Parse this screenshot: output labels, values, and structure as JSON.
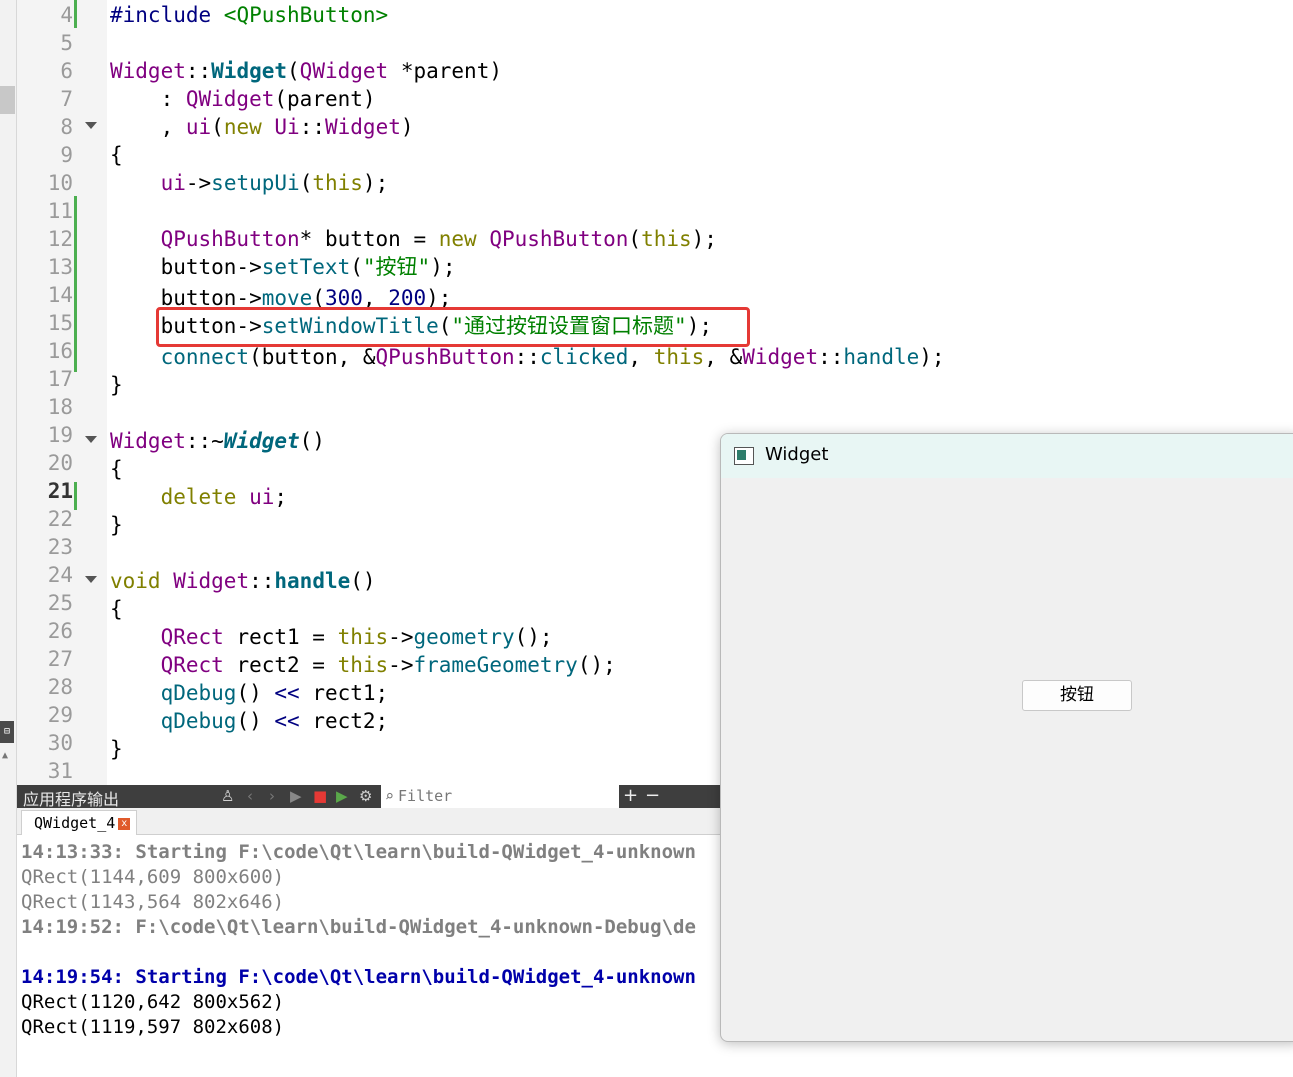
{
  "editor": {
    "line_numbers": [
      "4",
      "5",
      "6",
      "7",
      "8",
      "9",
      "10",
      "11",
      "12",
      "13",
      "14",
      "15",
      "16",
      "17",
      "18",
      "19",
      "20",
      "21",
      "22",
      "23",
      "24",
      "25",
      "26",
      "27",
      "28",
      "29",
      "30",
      "31"
    ],
    "current_line": "21",
    "lines": {
      "l4": {
        "a": "#include ",
        "b": "<QPushButton>"
      },
      "l6": {
        "a": "Widget",
        "b": "::",
        "c": "Widget",
        "d": "(",
        "e": "QWidget",
        "f": " *parent)"
      },
      "l7": {
        "a": "    : ",
        "b": "QWidget",
        "c": "(parent)"
      },
      "l8": {
        "a": "    , ",
        "b": "ui",
        "c": "(",
        "d": "new",
        "e": " ",
        "f": "Ui",
        "g": "::",
        "h": "Widget",
        "i": ")"
      },
      "l9": {
        "a": "{"
      },
      "l10": {
        "a": "    ",
        "b": "ui",
        "c": "->",
        "d": "setupUi",
        "e": "(",
        "f": "this",
        "g": ");"
      },
      "l12": {
        "a": "    ",
        "b": "QPushButton",
        "c": "* button = ",
        "d": "new",
        "e": " ",
        "f": "QPushButton",
        "g": "(",
        "h": "this",
        "i": ");"
      },
      "l13": {
        "a": "    button->",
        "b": "setText",
        "c": "(",
        "d": "\"按钮\"",
        "e": ");"
      },
      "l14": {
        "a": "    button->",
        "b": "move",
        "c": "(",
        "d": "300",
        "e": ", ",
        "f": "200",
        "g": ");"
      },
      "l15": {
        "a": "    button->",
        "b": "setWindowTitle",
        "c": "(",
        "d": "\"通过按钮设置窗口标题\"",
        "e": ");"
      },
      "l16": {
        "a": "    ",
        "b": "connect",
        "c": "(button, &",
        "d": "QPushButton",
        "e": "::",
        "f": "clicked",
        "g": ", ",
        "h": "this",
        "i": ", &",
        "j": "Widget",
        "k": "::",
        "l": "handle",
        "m": ");"
      },
      "l17": {
        "a": "}"
      },
      "l19": {
        "a": "Widget",
        "b": "::~",
        "c": "Widget",
        "d": "()"
      },
      "l20": {
        "a": "{"
      },
      "l21": {
        "a": "    ",
        "b": "delete",
        "c": " ",
        "d": "ui",
        "e": ";"
      },
      "l22": {
        "a": "}"
      },
      "l24": {
        "a": "void",
        "b": " ",
        "c": "Widget",
        "d": "::",
        "e": "handle",
        "f": "()"
      },
      "l25": {
        "a": "{"
      },
      "l26": {
        "a": "    ",
        "b": "QRect",
        "c": " rect1 = ",
        "d": "this",
        "e": "->",
        "f": "geometry",
        "g": "();"
      },
      "l27": {
        "a": "    ",
        "b": "QRect",
        "c": " rect2 = ",
        "d": "this",
        "e": "->",
        "f": "frameGeometry",
        "g": "();"
      },
      "l28": {
        "a": "    ",
        "b": "qDebug",
        "c": "() ",
        "d": "<<",
        "e": " rect1;"
      },
      "l29": {
        "a": "    ",
        "b": "qDebug",
        "c": "() ",
        "d": "<<",
        "e": " rect2;"
      },
      "l30": {
        "a": "}"
      }
    }
  },
  "output": {
    "title": "应用程序输出",
    "filter_placeholder": "Filter",
    "plus": "+",
    "minus": "−",
    "tab_label": "QWidget_4",
    "tab_close": "x",
    "lines": [
      "14:13:33: Starting F:\\code\\Qt\\learn\\build-QWidget_4-unknown",
      "QRect(1144,609 800x600)",
      "QRect(1143,564 802x646)",
      "14:19:52: F:\\code\\Qt\\learn\\build-QWidget_4-unknown-Debug\\de",
      "14:19:54: Starting F:\\code\\Qt\\learn\\build-QWidget_4-unknown",
      "QRect(1120,642 800x562)",
      "QRect(1119,597 802x608)"
    ]
  },
  "window": {
    "title": "Widget",
    "button_label": "按钮"
  },
  "colors": {
    "highlight_box": "#e53935",
    "keyword": "#808000",
    "type": "#800080",
    "function": "#00677c",
    "string": "#008000",
    "output_starting": "#0000aa"
  }
}
